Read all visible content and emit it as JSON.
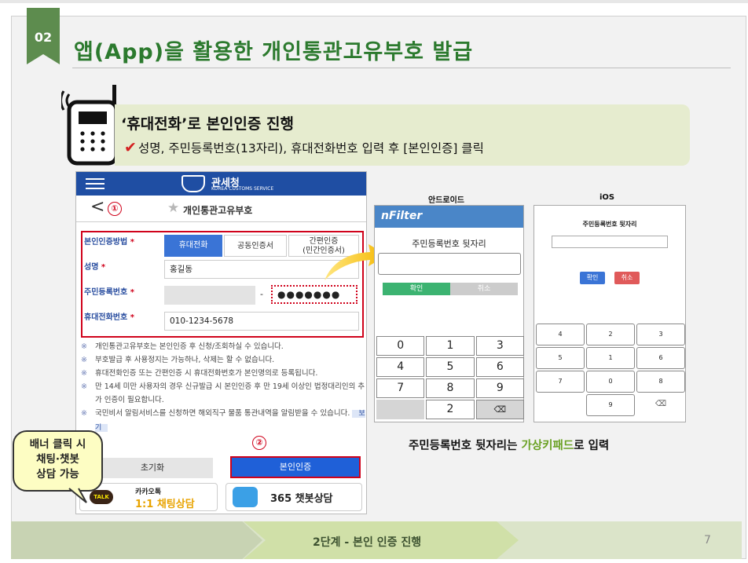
{
  "slide": {
    "number": "02",
    "title": "앱(App)을  활용한  개인통관고유부호  발급",
    "page": "7"
  },
  "callout": {
    "heading": "‘휴대전화’로  본인인증  진행",
    "check": "✔",
    "text": "성명, 주민등록번호(13자리), 휴대전화번호  입력 후 [본인인증]  클릭"
  },
  "app": {
    "org": "관세청",
    "org_sub": "KOREA CUSTOMS SERVICE",
    "nav_title": "개인통관고유부호",
    "back": "<",
    "marker1": "①",
    "marker2": "②",
    "auth_label": "본인인증방법",
    "tabs": [
      "휴대전화",
      "공동인증서",
      "간편인증\n(민간인증서)"
    ],
    "name_label": "성명",
    "name_value": "홍길동",
    "rrn_label": "주민등록번호",
    "rrn_back": "●●●●●●●",
    "dash": "-",
    "phone_label": "휴대전화번호",
    "phone_value": "010-1234-5678",
    "required": "*",
    "notes": [
      "개인통관고유부호는 본인인증 후 신청/조회하실 수 있습니다.",
      "부호발급 후 사용정지는 가능하나, 삭제는 할 수 없습니다.",
      "휴대전화인증 또는 간편인증 시 휴대전화번호가 본인명의로 등록됩니다.",
      "만 14세 미만 사용자의 경우 신규발급 시 본인인증 후 만 19세 이상인 법정대리인의 추가 인증이 필요합니다.",
      "국민비서 알림서비스를 신청하면 해외직구 물품 통관내역을 알림받을 수 있습니다."
    ],
    "view_btn": "보기",
    "reset_btn": "초기화",
    "auth_btn": "본인인증",
    "banner1_top": "카카오톡",
    "banner1_bottom": "1:1 채팅상담",
    "talk": "TALK",
    "banner2": "365 챗봇상담"
  },
  "android": {
    "label": "안드로이드",
    "brand": "nFilter",
    "prompt": "주민등록번호 뒷자리",
    "ok": "확인",
    "cancel": "취소",
    "keys": [
      "0",
      "1",
      "3",
      "4",
      "5",
      "6",
      "7",
      "8",
      "9",
      "",
      "2",
      "⌫"
    ]
  },
  "ios": {
    "label": "iOS",
    "prompt": "주민등록번호 뒷자리",
    "ok": "확인",
    "cancel": "취소",
    "keys": [
      "4",
      "2",
      "3",
      "5",
      "1",
      "6",
      "7",
      "0",
      "8",
      "",
      "9",
      "⌫"
    ]
  },
  "caption": {
    "pre": "주민등록번호 뒷자리는 ",
    "hl": "가상키패드",
    "post": "로 입력"
  },
  "bubble": [
    "배너 클릭 시",
    "채팅·챗봇",
    "상담 가능"
  ],
  "footer": {
    "step": "2단계 - 본인 인증 진행"
  },
  "colors": {
    "accent": "#2c7a2e",
    "badge": "#5d8c4e",
    "highlight": "#d0021b",
    "app_blue": "#1f4ea3",
    "nfilter": "#4a86c8"
  }
}
